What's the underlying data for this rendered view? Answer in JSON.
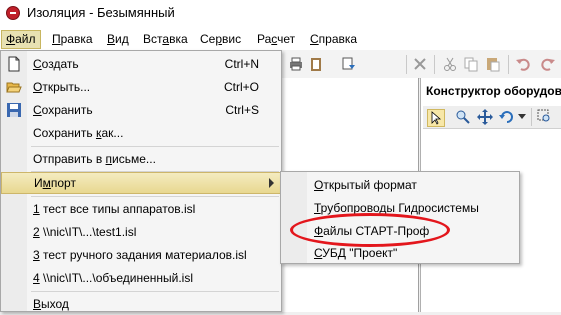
{
  "window": {
    "title": "Изоляция - Безымянный"
  },
  "menubar": {
    "items": [
      {
        "prefix": "",
        "accel": "Ф",
        "rest": "айл"
      },
      {
        "prefix": "",
        "accel": "П",
        "rest": "равка"
      },
      {
        "prefix": "",
        "accel": "В",
        "rest": "ид"
      },
      {
        "prefix": "Вст",
        "accel": "а",
        "rest": "вка"
      },
      {
        "prefix": "Се",
        "accel": "р",
        "rest": "вис"
      },
      {
        "prefix": "Ра",
        "accel": "с",
        "rest": "чет"
      },
      {
        "prefix": "",
        "accel": "С",
        "rest": "правка"
      }
    ]
  },
  "file_menu": {
    "create": {
      "accel": "С",
      "rest": "оздать",
      "shortcut": "Ctrl+N"
    },
    "open": {
      "accel": "О",
      "rest": "ткрыть...",
      "shortcut": "Ctrl+O"
    },
    "save": {
      "accel": "С",
      "rest": "охранить",
      "shortcut": "Ctrl+S"
    },
    "save_as": {
      "prefix": "Сохранить ",
      "accel": "к",
      "rest": "ак..."
    },
    "send_mail": {
      "prefix": "Отправить в ",
      "accel": "п",
      "rest": "исьме..."
    },
    "import": {
      "prefix": "И",
      "accel": "м",
      "rest": "порт"
    },
    "recent": [
      {
        "accel": "1",
        "rest": " тест все типы аппаратов.isl"
      },
      {
        "accel": "2",
        "rest": " \\\\nic\\IT\\...\\test1.isl"
      },
      {
        "accel": "3",
        "rest": " тест ручного задания материалов.isl"
      },
      {
        "accel": "4",
        "rest": " \\\\nic\\IT\\...\\объединенный.isl"
      }
    ],
    "exit": {
      "accel": "В",
      "rest": "ыход"
    }
  },
  "import_submenu": {
    "items": [
      {
        "prefix": "",
        "accel": "О",
        "rest": "ткрытый формат"
      },
      {
        "prefix": "",
        "accel": "Т",
        "rest": "рубопроводы Гидросистемы"
      },
      {
        "prefix": "",
        "accel": "Ф",
        "rest": "айлы СТАРТ-Проф"
      },
      {
        "prefix": "",
        "accel": "С",
        "rest": "УБД \"Проект\""
      }
    ]
  },
  "right_panel": {
    "title": "Конструктор оборудова"
  },
  "colors": {
    "highlight": "#e8d890",
    "annotation": "#e3161c"
  },
  "icons": [
    "new-document-icon",
    "open-folder-icon",
    "save-disk-icon",
    "cut-icon",
    "copy-icon",
    "paste-icon",
    "undo-icon",
    "redo-icon",
    "pointer-icon",
    "zoom-icon",
    "pan-icon",
    "rotate-icon"
  ]
}
